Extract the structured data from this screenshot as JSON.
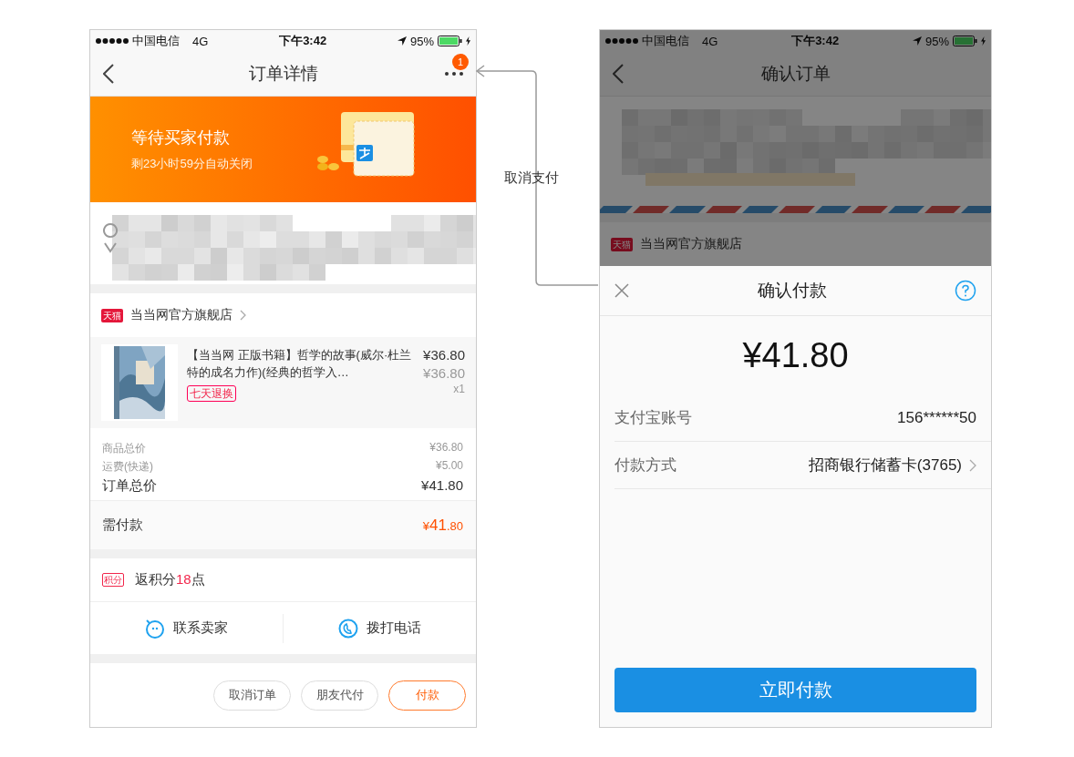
{
  "order_screen": {
    "status_bar": {
      "carrier": "中国电信",
      "network": "4G",
      "time": "下午3:42",
      "battery": "95%"
    },
    "nav": {
      "title": "订单详情",
      "badge": "1"
    },
    "banner": {
      "title": "等待买家付款",
      "subtitle": "剩23小时59分自动关闭"
    },
    "shop": {
      "logo": "天猫",
      "name": "当当网官方旗舰店"
    },
    "product": {
      "title": "【当当网 正版书籍】哲学的故事(威尔·杜兰特的成名力作)(经典的哲学入…",
      "tag": "七天退换",
      "price": "¥36.80",
      "original_price": "¥36.80",
      "quantity": "x1"
    },
    "summary": [
      {
        "label": "商品总价",
        "value": "¥36.80",
        "kind": "minor"
      },
      {
        "label": "运费(快递)",
        "value": "¥5.00",
        "kind": "minor"
      },
      {
        "label": "订单总价",
        "value": "¥41.80",
        "kind": "total"
      }
    ],
    "due": {
      "label": "需付款",
      "currency": "¥",
      "integer": "41",
      "decimal": ".80"
    },
    "points": {
      "tag": "积分",
      "prefix": "返积分",
      "number": "18",
      "suffix": "点"
    },
    "actions": [
      {
        "label": "联系卖家",
        "kind": "chat"
      },
      {
        "label": "拨打电话",
        "kind": "phone"
      }
    ],
    "buttons": [
      {
        "label": "取消订单",
        "primary": false
      },
      {
        "label": "朋友代付",
        "primary": false
      },
      {
        "label": "付款",
        "primary": true
      }
    ]
  },
  "connector": {
    "label": "取消支付"
  },
  "payment_screen": {
    "status_bar": {
      "carrier": "中国电信",
      "network": "4G",
      "time": "下午3:42",
      "battery": "95%"
    },
    "nav": {
      "title": "确认订单"
    },
    "shop": {
      "logo": "天猫",
      "name": "当当网官方旗舰店"
    },
    "sheet": {
      "title": "确认付款",
      "amount": "¥41.80",
      "rows": [
        {
          "label": "支付宝账号",
          "value": "156******50",
          "chevron": false
        },
        {
          "label": "付款方式",
          "value": "招商银行储蓄卡(3765)",
          "chevron": true
        }
      ],
      "button": "立即付款"
    }
  }
}
